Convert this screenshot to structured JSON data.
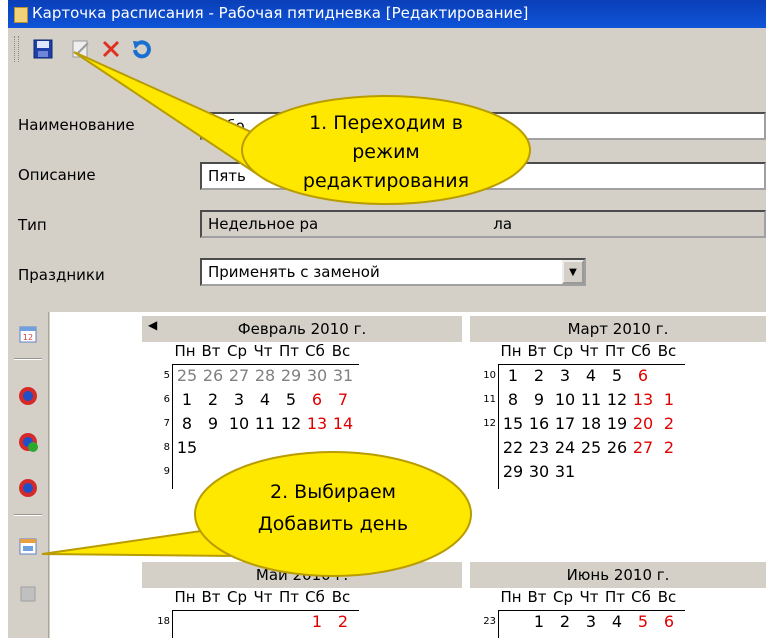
{
  "window": {
    "title": "Карточка расписания - Рабочая пятидневка [Редактирование]"
  },
  "toolbar": {
    "icons": [
      "save-icon",
      "edit-icon",
      "delete-icon",
      "undo-icon"
    ],
    "colors": {
      "save": "#1f3fa8",
      "delete": "#e03020",
      "undo": "#1a6fd0"
    }
  },
  "form": {
    "name_label": "Наименование",
    "name_value": "Рабо",
    "desc_label": "Описание",
    "desc_value": "Пять",
    "type_label": "Тип",
    "type_value": "Недельное ра",
    "type_value_tail": "ла",
    "holidays_label": "Праздники",
    "holidays_value": "Применять с заменой"
  },
  "sidebar": {
    "icons": [
      "calendar-icon",
      "refresh-icon",
      "refresh-check-icon",
      "refresh-alt-icon",
      "add-day-icon",
      "disabled-icon"
    ]
  },
  "calendar": {
    "day_names": [
      "Пн",
      "Вт",
      "Ср",
      "Чт",
      "Пт",
      "Сб",
      "Вс"
    ],
    "months": [
      {
        "title": "Февраль 2010 г.",
        "weeks": [
          {
            "num": "5",
            "days": [
              "25",
              "26",
              "27",
              "28",
              "29",
              "30",
              "31"
            ]
          },
          {
            "num": "6",
            "days": [
              "1",
              "2",
              "3",
              "4",
              "5",
              "6",
              "7"
            ]
          },
          {
            "num": "7",
            "days": [
              "8",
              "9",
              "10",
              "11",
              "12",
              "13",
              "14"
            ]
          },
          {
            "num": "8",
            "days": [
              "15",
              "",
              "",
              "",
              "",
              "",
              ""
            ]
          },
          {
            "num": "9",
            "days": [
              "",
              "",
              "",
              "",
              "",
              "",
              ""
            ]
          }
        ]
      },
      {
        "title": "Март 2010 г.",
        "weeks": [
          {
            "num": "10",
            "days": [
              "1",
              "2",
              "3",
              "4",
              "5",
              "6",
              ""
            ]
          },
          {
            "num": "11",
            "days": [
              "8",
              "9",
              "10",
              "11",
              "12",
              "13",
              "1"
            ]
          },
          {
            "num": "12",
            "days": [
              "15",
              "16",
              "17",
              "18",
              "19",
              "20",
              "2"
            ]
          },
          {
            "num": "",
            "days": [
              "22",
              "23",
              "24",
              "25",
              "26",
              "27",
              "2"
            ]
          },
          {
            "num": "",
            "days": [
              "29",
              "30",
              "31",
              "",
              "",
              "",
              ""
            ]
          }
        ]
      },
      {
        "title": "Май 2010 г.",
        "weeks": [
          {
            "num": "18",
            "days": [
              "",
              "",
              "",
              "",
              "",
              "1",
              "2"
            ]
          }
        ]
      },
      {
        "title": "Июнь 2010 г.",
        "weeks": [
          {
            "num": "23",
            "days": [
              "",
              "1",
              "2",
              "3",
              "4",
              "5",
              "6"
            ]
          }
        ]
      }
    ]
  },
  "callouts": {
    "first": [
      "1. Переходим в",
      "режим",
      "редактирования"
    ],
    "second": [
      "2. Выбираем",
      "Добавить день"
    ],
    "fill": "#ffe800",
    "stroke": "#b89c00"
  }
}
